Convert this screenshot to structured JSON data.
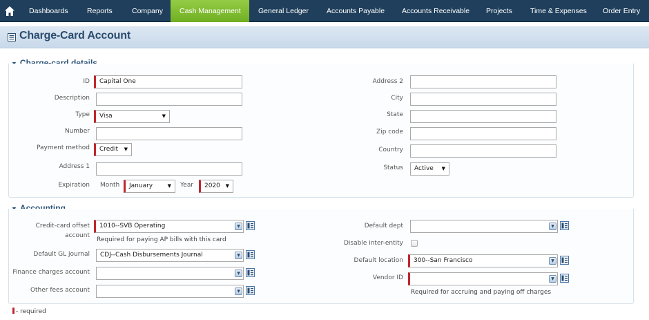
{
  "nav": {
    "items": [
      "Dashboards",
      "Reports",
      "Company",
      "Cash Management",
      "General Ledger",
      "Accounts Payable",
      "Accounts Receivable",
      "Projects",
      "Time & Expenses",
      "Order Entry"
    ],
    "active": "Cash Management",
    "active_color": "#7fbd2c",
    "bg_color": "#1f3f5c"
  },
  "page": {
    "title": "Charge-Card Account",
    "title_icon": "list-icon"
  },
  "details": {
    "header": "Charge-card details",
    "id": {
      "label": "ID",
      "value": "Capital One"
    },
    "description": {
      "label": "Description",
      "value": ""
    },
    "type": {
      "label": "Type",
      "value": "Visa"
    },
    "number": {
      "label": "Number",
      "value": ""
    },
    "payment_method": {
      "label": "Payment method",
      "value": "Credit"
    },
    "address1": {
      "label": "Address 1",
      "value": ""
    },
    "expiration": {
      "label": "Expiration",
      "month_label": "Month",
      "month": "January",
      "year_label": "Year",
      "year": "2020"
    },
    "address2": {
      "label": "Address 2",
      "value": ""
    },
    "city": {
      "label": "City",
      "value": ""
    },
    "state": {
      "label": "State",
      "value": ""
    },
    "zip": {
      "label": "Zip code",
      "value": ""
    },
    "country": {
      "label": "Country",
      "value": ""
    },
    "status": {
      "label": "Status",
      "value": "Active"
    }
  },
  "accounting": {
    "header": "Accounting",
    "offset_account": {
      "label_line1": "Credit-card offset",
      "label_line2": "account",
      "value": "1010--SVB Operating",
      "hint": "Required for paying AP bills with this card"
    },
    "gl_journal": {
      "label": "Default GL journal",
      "value": "CDJ--Cash Disbursements Journal"
    },
    "finance_charges": {
      "label": "Finance charges account",
      "value": ""
    },
    "other_fees": {
      "label": "Other fees account",
      "value": ""
    },
    "default_dept": {
      "label": "Default dept",
      "value": ""
    },
    "disable_inter_entity": {
      "label": "Disable inter-entity",
      "checked": false
    },
    "default_location": {
      "label": "Default location",
      "value": "300--San Francisco"
    },
    "vendor_id": {
      "label": "Vendor ID",
      "value": "",
      "hint": "Required for accruing and paying off charges"
    }
  },
  "legend": {
    "text": "- required"
  },
  "colors": {
    "required": "#c0262d",
    "section_header": "#2b5077",
    "title_bar": "#c8d9ea"
  }
}
